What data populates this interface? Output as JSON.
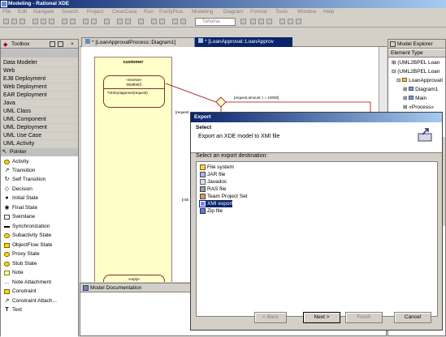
{
  "window": {
    "title": "Modeling - Rational XDE"
  },
  "menu": [
    "File",
    "Edit",
    "Navigate",
    "Search",
    "Project",
    "ClearCase",
    "Run",
    "PurifyPlus",
    "Modeling",
    "Diagram",
    "Format",
    "Tools",
    "Window",
    "Help"
  ],
  "toolbar": {
    "font": "Tahoma"
  },
  "toolbox": {
    "tab_label": "Toolbox",
    "categories": [
      "Data Modeler",
      "Web",
      "EJB Deployment",
      "Web Deployment",
      "EAR Deployment",
      "Java",
      "UML Class",
      "UML Component",
      "UML Deployment",
      "UML Use Case",
      "UML Activity"
    ],
    "tools": [
      "Pointer",
      "Activity",
      "Transition",
      "Self Transition",
      "Decision",
      "Initial State",
      "Final State",
      "Swimlane",
      "Synchronization",
      "Subactivity State",
      "ObjectFlow State",
      "Proxy State",
      "Stub State",
      "Note",
      "Note Attachment",
      "Constraint",
      "Constraint Attach...",
      "Text"
    ]
  },
  "editor": {
    "tabs": [
      "* [LoanApprovalProcess::Diagram1]",
      "* [LoanApproval::LoanApprov"
    ],
    "swimlane_name": "customer",
    "state_stereotype": "«receive»",
    "state_name": "receive1",
    "state_action": "Entry/approve(request)",
    "reply_label": "«reply»",
    "guard_label": "[request.amount > = 10000]",
    "partial_label_1": "[request",
    "partial_label_2": "[risk"
  },
  "doc_panel": {
    "title": "Model Documentation"
  },
  "explorer": {
    "title": "Model Explorer",
    "header": "Element Type",
    "items": [
      "(UML2BPEL Loan",
      "(UML2BPEL Loan",
      "LoanApprovalI",
      "Diagram1",
      "Main",
      "«Process»"
    ]
  },
  "dialog": {
    "title": "Export",
    "section": "Select",
    "subtitle": "Export an XDE model to XMI file",
    "list_label": "Select an export destination:",
    "items": [
      "File system",
      "JAR file",
      "Javadoc",
      "RAS file",
      "Team Project Set",
      "XMI export",
      "Zip file"
    ],
    "selected_index": 5,
    "buttons": {
      "back": "< Back",
      "next": "Next >",
      "finish": "Finish",
      "cancel": "Cancel"
    }
  }
}
